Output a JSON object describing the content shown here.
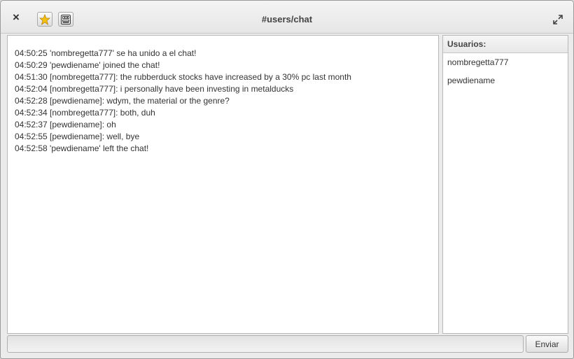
{
  "window": {
    "title": "#users/chat"
  },
  "toolbar": {
    "close_icon": "×",
    "star_icon": "star-icon",
    "keys_icon": "keyboard-icon",
    "maximize_icon": "maximize-icon",
    "accent_color": "#f5c211"
  },
  "chat": {
    "messages": [
      "04:50:25 'nombregetta777' se ha unido a el chat!",
      "04:50:29 'pewdiename' joined the chat!",
      "04:51:30 [nombregetta777]: the rubberduck stocks have increased by a 30% pc last month",
      "04:52:04 [nombregetta777]: i personally have been investing in metalducks",
      "04:52:28 [pewdiename]: wdym, the material or the genre?",
      "04:52:34 [nombregetta777]: both, duh",
      "04:52:37 [pewdiename]: oh",
      "04:52:55 [pewdiename]: well, bye",
      "04:52:58 'pewdiename' left the chat!"
    ]
  },
  "users": {
    "header": "Usuarios:",
    "list": [
      "nombregetta777",
      "pewdiename"
    ]
  },
  "composer": {
    "input_value": "",
    "send_label": "Enviar"
  }
}
